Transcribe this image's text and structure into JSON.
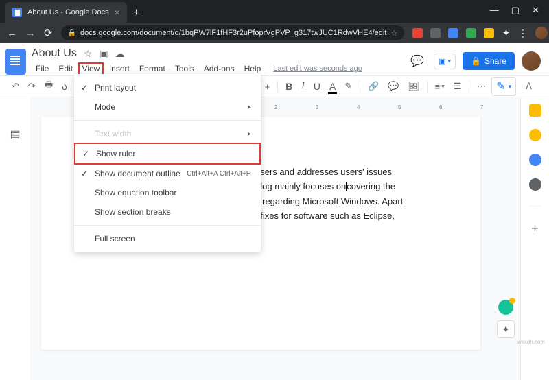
{
  "browser": {
    "tab_title": "About Us - Google Docs",
    "url": "docs.google.com/document/d/1bqPW7lF1fHF3r2uPfoprVgPVP_g317twJUC1RdwVHE4/edit"
  },
  "header": {
    "title": "About Us",
    "menus": {
      "file": "File",
      "edit": "Edit",
      "view": "View",
      "insert": "Insert",
      "format": "Format",
      "tools": "Tools",
      "addons": "Add-ons",
      "help": "Help"
    },
    "last_edit": "Last edit was seconds ago",
    "share": "Share"
  },
  "view_menu": {
    "print_layout": "Print layout",
    "mode": "Mode",
    "text_width": "Text width",
    "show_ruler": "Show ruler",
    "show_outline": "Show document outline",
    "show_outline_shortcut": "Ctrl+Alt+A Ctrl+Alt+H",
    "show_eq_toolbar": "Show equation toolbar",
    "show_section_breaks": "Show section breaks",
    "full_screen": "Full screen"
  },
  "ruler_ticks": [
    "2",
    "3",
    "4",
    "5",
    "6",
    "7"
  ],
  "document": {
    "line1_vis": "users and addresses users' issues",
    "line2_vis_a": "blog mainly focuses on",
    "line2_vis_b": "covering the",
    "line3_vis": "s regarding Microsoft Windows. Apart",
    "line4_vis": "t fixes for software such as Eclipse,"
  },
  "watermark": "wsxdn.com"
}
